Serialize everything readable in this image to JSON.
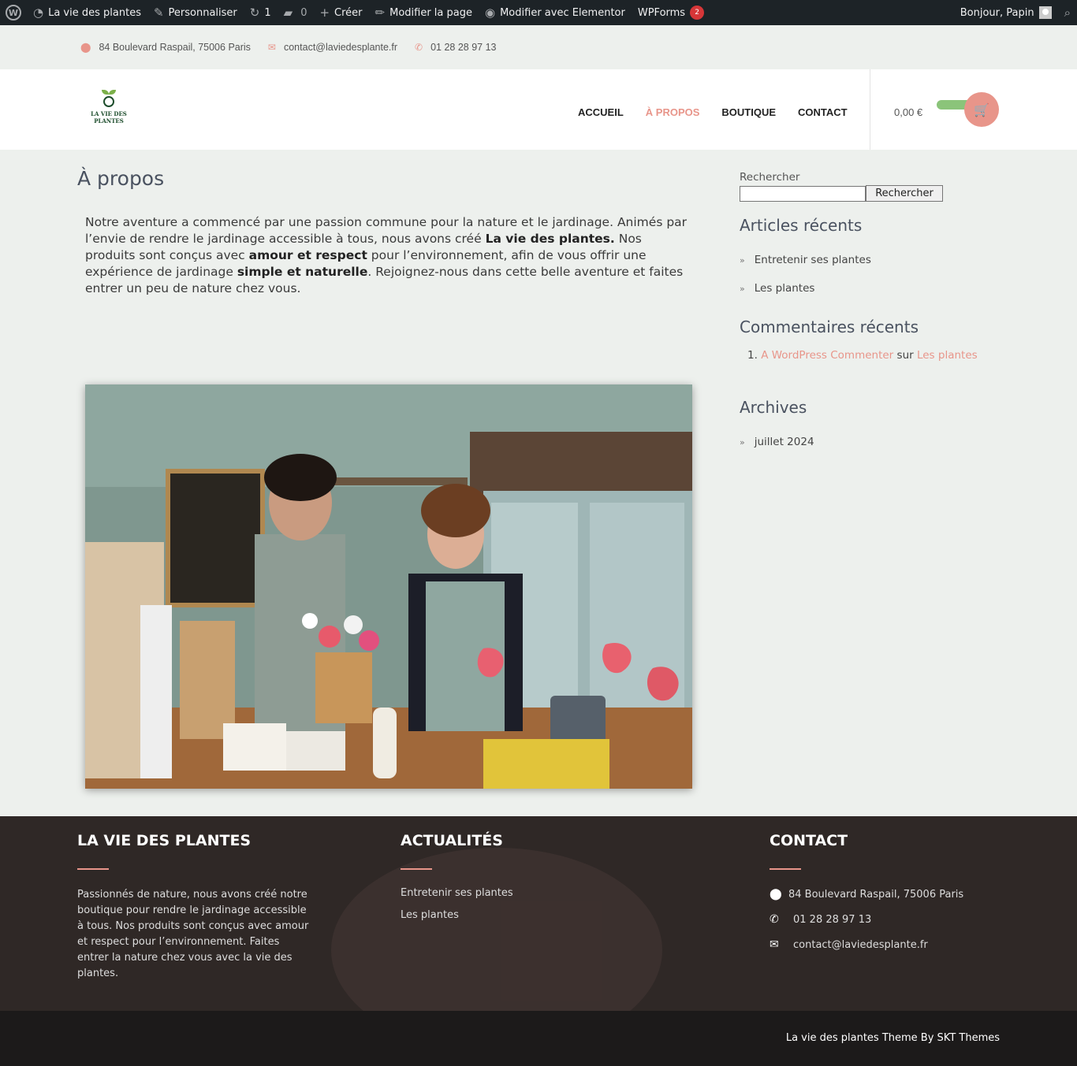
{
  "adminbar": {
    "site_name": "La vie des plantes",
    "customize": "Personnaliser",
    "updates_count": "1",
    "comments_count": "0",
    "new": "Créer",
    "edit_page": "Modifier la page",
    "elementor": "Modifier avec Elementor",
    "wpforms": "WPForms",
    "wpforms_badge": "2",
    "greeting": "Bonjour, Papin"
  },
  "topbar": {
    "address": "84 Boulevard Raspail, 75006 Paris",
    "email": "contact@laviedesplante.fr",
    "phone": "01 28 28 97 13"
  },
  "header": {
    "logo_line1": "LA VIE DES",
    "logo_line2": "PLANTES",
    "nav": [
      "ACCUEIL",
      "À PROPOS",
      "BOUTIQUE",
      "CONTACT"
    ],
    "cart_total": "0,00 €"
  },
  "main": {
    "title": "À propos",
    "intro_1": "Notre aventure a commencé par une passion commune pour la nature et le jardinage. Animés par l’envie de rendre le jardinage accessible à tous, nous avons créé ",
    "intro_b1": "La vie des plantes.",
    "intro_2": " Nos produits sont conçus avec ",
    "intro_b2": "amour et respect",
    "intro_3": " pour l’environnement, afin de vous offrir une expérience de jardinage ",
    "intro_b3": "simple et naturelle",
    "intro_4": ". Rejoignez-nous dans cette belle aventure et faites entrer un peu de nature chez vous."
  },
  "sidebar": {
    "search_label": "Rechercher",
    "search_button": "Rechercher",
    "recent_posts_title": "Articles récents",
    "recent_posts": [
      "Entretenir ses plantes",
      "Les plantes"
    ],
    "recent_comments_title": "Commentaires récents",
    "comment_num": "1.",
    "comment_author": "A WordPress Commenter",
    "comment_on": "sur",
    "comment_post": "Les plantes",
    "archives_title": "Archives",
    "archives": [
      "juillet 2024"
    ]
  },
  "footer": {
    "col1_title": "LA VIE DES PLANTES",
    "col1_text": "Passionnés de nature, nous avons créé notre boutique pour rendre le jardinage accessible à tous. Nos produits sont conçus avec amour et respect pour l’environnement. Faites entrer la nature chez vous avec la vie des plantes.",
    "col2_title": "ACTUALITÉS",
    "col2_links": [
      "Entretenir ses plantes",
      "Les plantes"
    ],
    "col3_title": "CONTACT",
    "address": "84 Boulevard Raspail, 75006 Paris",
    "phone": "01 28 28 97 13",
    "email": "contact@laviedesplante.fr",
    "credit": "La vie des plantes Theme By SKT Themes"
  },
  "colors": {
    "accent": "#e8958a",
    "admin_bar": "#1d2327",
    "page_bg": "#edf0ed",
    "footer_bg": "#2f2826"
  }
}
